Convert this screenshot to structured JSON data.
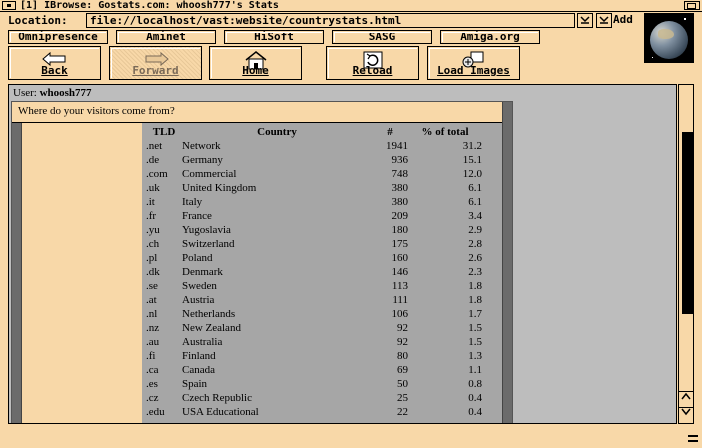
{
  "window": {
    "title": "[1] IBrowse: Gostats.com: whoosh777's Stats"
  },
  "location": {
    "label": "Location:",
    "url": "file://localhost/vast:website/countrystats.html",
    "add_label": "Add"
  },
  "hotlist": [
    "Omnipresence",
    "Aminet",
    "HiSoft",
    "SASG",
    "Amiga.org"
  ],
  "nav": {
    "back": "Back",
    "forward": "Forward",
    "home": "Home",
    "reload": "Reload",
    "load_images": "Load Images"
  },
  "page": {
    "user_label": "User:",
    "user_name": "whoosh777",
    "heading": "Where do your visitors come from?",
    "columns": [
      "TLD",
      "Country",
      "#",
      "% of total"
    ],
    "rows": [
      [
        ".net",
        "Network",
        "1941",
        "31.2"
      ],
      [
        ".de",
        "Germany",
        "936",
        "15.1"
      ],
      [
        ".com",
        "Commercial",
        "748",
        "12.0"
      ],
      [
        ".uk",
        "United Kingdom",
        "380",
        "6.1"
      ],
      [
        ".it",
        "Italy",
        "380",
        "6.1"
      ],
      [
        ".fr",
        "France",
        "209",
        "3.4"
      ],
      [
        ".yu",
        "Yugoslavia",
        "180",
        "2.9"
      ],
      [
        ".ch",
        "Switzerland",
        "175",
        "2.8"
      ],
      [
        ".pl",
        "Poland",
        "160",
        "2.6"
      ],
      [
        ".dk",
        "Denmark",
        "146",
        "2.3"
      ],
      [
        ".se",
        "Sweden",
        "113",
        "1.8"
      ],
      [
        ".at",
        "Austria",
        "111",
        "1.8"
      ],
      [
        ".nl",
        "Netherlands",
        "106",
        "1.7"
      ],
      [
        ".nz",
        "New Zealand",
        "92",
        "1.5"
      ],
      [
        ".au",
        "Australia",
        "92",
        "1.5"
      ],
      [
        ".fi",
        "Finland",
        "80",
        "1.3"
      ],
      [
        ".ca",
        "Canada",
        "69",
        "1.1"
      ],
      [
        ".es",
        "Spain",
        "50",
        "0.8"
      ],
      [
        ".cz",
        "Czech Republic",
        "25",
        "0.4"
      ],
      [
        ".edu",
        "USA Educational",
        "22",
        "0.4"
      ]
    ]
  },
  "icons": {
    "window_close": "close-icon",
    "window_depth": "depth-icon",
    "location_dropdown": "chevron-down-icon",
    "location_history": "history-icon",
    "logo": "globe-icon",
    "back": "arrow-left-icon",
    "forward": "arrow-right-icon",
    "home": "house-icon",
    "reload": "reload-icon",
    "load_images": "images-icon",
    "scroll_up": "chevron-up-icon",
    "scroll_down": "chevron-down-icon",
    "sizer": "resize-icon"
  },
  "colors": {
    "chrome": "#f8d8a8",
    "viewport_bg": "#bdbdbd",
    "table_bg": "#a6a6a6",
    "frame_border": "#6b6b6b"
  }
}
